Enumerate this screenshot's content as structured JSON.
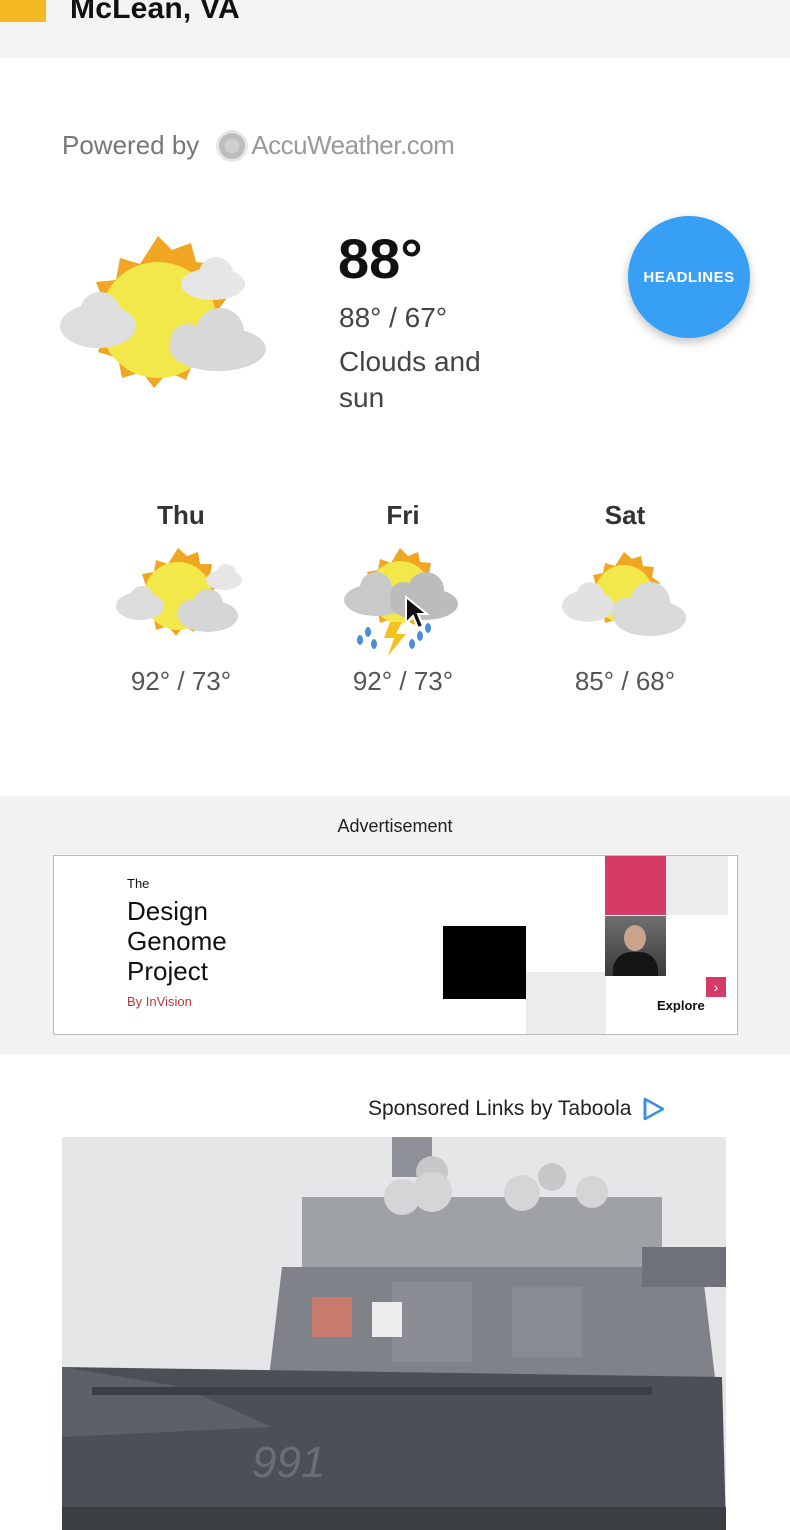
{
  "header": {
    "location": "McLean, VA",
    "accent_color": "#f5b922"
  },
  "powered": {
    "label": "Powered by",
    "brand": "AccuWeather.com"
  },
  "current": {
    "temp": "88°",
    "range": "88° / 67°",
    "condition": "Clouds and sun",
    "icon": "sun-with-clouds-icon"
  },
  "headlines_button": {
    "label": "HEADLINES",
    "color": "#38a0f4"
  },
  "forecast": [
    {
      "day": "Thu",
      "range": "92° / 73°",
      "icon": "sun-with-clouds-icon"
    },
    {
      "day": "Fri",
      "range": "92° / 73°",
      "icon": "thunderstorm-icon"
    },
    {
      "day": "Sat",
      "range": "85° / 68°",
      "icon": "sun-with-clouds-icon"
    }
  ],
  "ad": {
    "label": "Advertisement",
    "small_title": "The",
    "title": "Design Genome Project",
    "byline": "By InVision",
    "cta": "Explore",
    "cta_icon": "chevron-right-icon",
    "accent_color": "#d53b66"
  },
  "taboola": {
    "label": "Sponsored Links by Taboola",
    "icon": "taboola-play-icon"
  },
  "sponsored_image": {
    "alt": "Navy destroyer 991",
    "hull_number": "991"
  }
}
